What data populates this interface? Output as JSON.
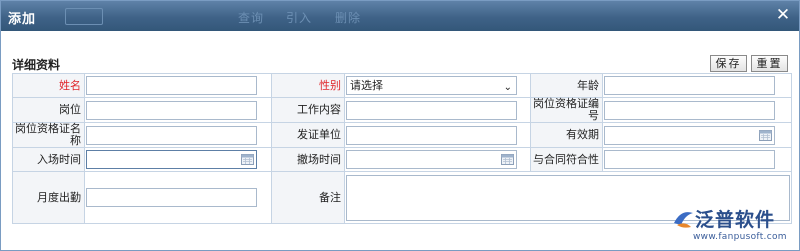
{
  "dialog": {
    "title": "添加",
    "close_glyph": "✕",
    "background_toolbar": [
      "查询",
      "引入",
      "删除"
    ]
  },
  "section_title": "详细资料",
  "actions": {
    "save": "保存",
    "reset": "重置"
  },
  "fields": {
    "name": "姓名",
    "gender": "性别",
    "gender_value": "请选择",
    "age": "年龄",
    "position": "岗位",
    "job_content": "工作内容",
    "cert_number": "岗位资格证编号",
    "cert_name": "岗位资格证名称",
    "issuer": "发证单位",
    "validity": "有效期",
    "entry_time": "入场时间",
    "exit_time": "撤场时间",
    "contract_match": "与合同符合性",
    "monthly_attendance": "月度出勤",
    "remarks": "备注"
  },
  "colors": {
    "titlebar": "#3f6287",
    "required": "#e0262a",
    "label_bg": "#f3f5f8",
    "border": "#c6d4e4"
  },
  "logo": {
    "brand": "泛普软件",
    "url": "www.fanpusoft.com"
  }
}
